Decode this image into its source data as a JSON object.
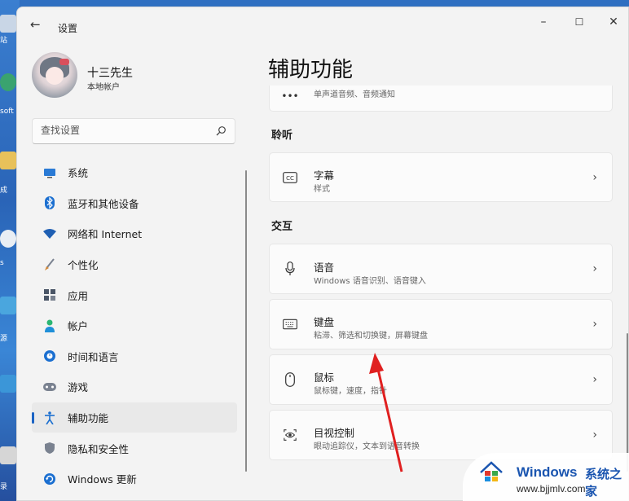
{
  "window": {
    "title": "设置",
    "back_glyph": "←",
    "minimize_glyph": "–",
    "maximize_glyph": "☐",
    "close_glyph": "✕"
  },
  "user": {
    "name": "十三先生",
    "type": "本地帐户"
  },
  "search": {
    "placeholder": "查找设置"
  },
  "nav": {
    "items": [
      {
        "label": "系统",
        "icon": "monitor-icon",
        "color": "#2a7ad5"
      },
      {
        "label": "蓝牙和其他设备",
        "icon": "bluetooth-icon",
        "color": "#1b6fd0"
      },
      {
        "label": "网络和 Internet",
        "icon": "wifi-icon",
        "color": "#1f5fb3"
      },
      {
        "label": "个性化",
        "icon": "brush-icon",
        "color": "#d48a3a"
      },
      {
        "label": "应用",
        "icon": "apps-icon",
        "color": "#4a5566"
      },
      {
        "label": "帐户",
        "icon": "person-icon",
        "color": "#2bb673"
      },
      {
        "label": "时间和语言",
        "icon": "globe-clock-icon",
        "color": "#1b6fd0"
      },
      {
        "label": "游戏",
        "icon": "gamepad-icon",
        "color": "#7a8290"
      },
      {
        "label": "辅助功能",
        "icon": "accessibility-icon",
        "color": "#1b6fd0",
        "active": true
      },
      {
        "label": "隐私和安全性",
        "icon": "shield-icon",
        "color": "#7a8290"
      },
      {
        "label": "Windows 更新",
        "icon": "update-icon",
        "color": "#1b6fd0"
      }
    ]
  },
  "main": {
    "title": "辅助功能",
    "partial_card": {
      "subtitle": "单声道音频、音频通知"
    },
    "sections": [
      {
        "header": "聆听",
        "cards": [
          {
            "title": "字幕",
            "subtitle": "样式",
            "icon": "cc-icon"
          }
        ]
      },
      {
        "header": "交互",
        "cards": [
          {
            "title": "语音",
            "subtitle": "Windows 语音识别、语音键入",
            "icon": "microphone-icon"
          },
          {
            "title": "键盘",
            "subtitle": "粘滞、筛选和切换键，屏幕键盘",
            "icon": "keyboard-icon"
          },
          {
            "title": "鼠标",
            "subtitle": "鼠标键，速度，指针",
            "icon": "mouse-icon"
          },
          {
            "title": "目视控制",
            "subtitle": "眼动追踪仪，文本到语音转换",
            "icon": "eye-control-icon"
          }
        ]
      }
    ],
    "chevron": "›"
  },
  "desktop": {
    "labels": [
      "站",
      "soft",
      "成",
      "s",
      "源",
      "录"
    ]
  },
  "watermark": {
    "brand": "Windows",
    "brand_suffix": "系统之家",
    "url": "www.bjjmlv.com"
  },
  "colors": {
    "accent": "#1a63c4",
    "arrow": "#e02020"
  }
}
